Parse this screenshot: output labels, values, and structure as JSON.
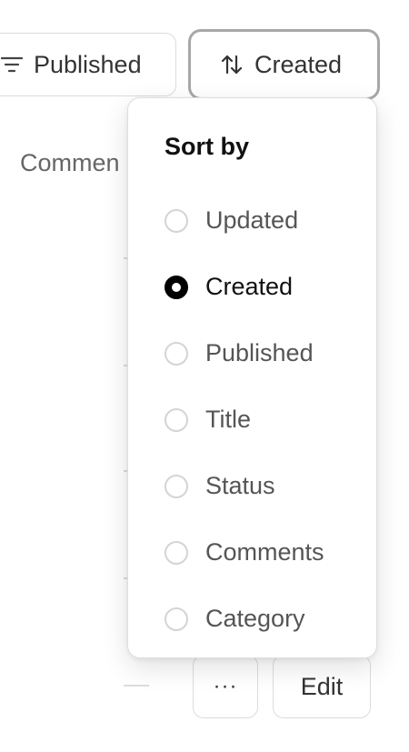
{
  "toolbar": {
    "filter_label": "Published",
    "sort_label": "Created"
  },
  "background": {
    "column_header": "Commen",
    "more_label": "···",
    "edit_label": "Edit"
  },
  "sort_menu": {
    "title": "Sort by",
    "selected": "Created",
    "options": [
      {
        "label": "Updated",
        "selected": false
      },
      {
        "label": "Created",
        "selected": true
      },
      {
        "label": "Published",
        "selected": false
      },
      {
        "label": "Title",
        "selected": false
      },
      {
        "label": "Status",
        "selected": false
      },
      {
        "label": "Comments",
        "selected": false
      },
      {
        "label": "Category",
        "selected": false
      }
    ]
  },
  "icons": {
    "filter": "filter-icon",
    "sort": "sort-arrows-icon"
  }
}
